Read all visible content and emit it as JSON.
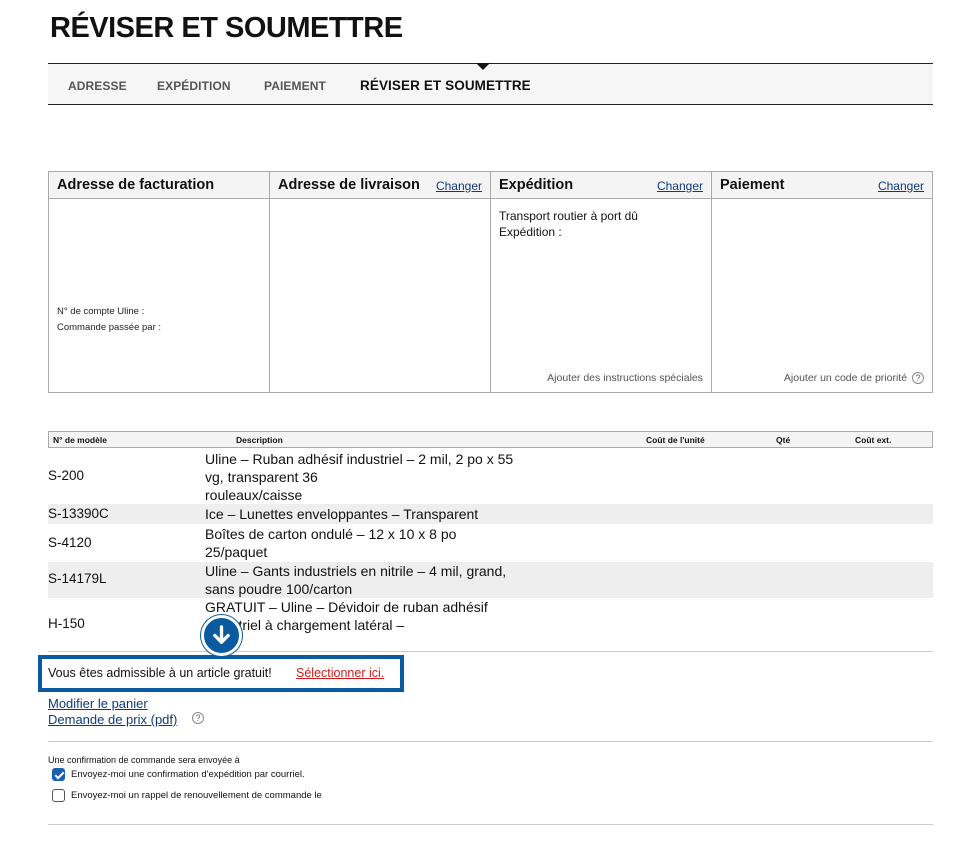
{
  "page": {
    "title": "RÉVISER ET SOUMETTRE"
  },
  "steps": [
    "ADRESSE",
    "EXPÉDITION",
    "PAIEMENT",
    "RÉVISER ET SOUMETTRE"
  ],
  "summary": {
    "billing": {
      "title": "Adresse de facturation",
      "account_label": "N° de compte Uline :",
      "ordered_by_label": "Commande passée par :"
    },
    "shipping_address": {
      "title": "Adresse de livraison",
      "change": "Changer"
    },
    "shipping": {
      "title": "Expédition",
      "change": "Changer",
      "line1": "Transport routier à port dû",
      "line2": "Expédition :",
      "special": "Ajouter des instructions spéciales"
    },
    "payment": {
      "title": "Paiement",
      "change": "Changer",
      "priority": "Ajouter un code de priorité",
      "help": "?"
    }
  },
  "table": {
    "headers": {
      "model": "N° de modèle",
      "description": "Description",
      "unit_cost": "Coût de l'unité",
      "qty": "Qté",
      "ext_cost": "Coût ext."
    },
    "rows": [
      {
        "model": "S-200",
        "lines": [
          "Uline – Ruban adhésif industriel – 2 mil, 2 po x 55",
          "vg, transparent 36",
          "rouleaux/caisse"
        ]
      },
      {
        "model": "S-13390C",
        "lines": [
          "Ice – Lunettes enveloppantes – Transparent"
        ]
      },
      {
        "model": "S-4120",
        "lines": [
          "Boîtes de carton ondulé – 12 x 10 x 8 po",
          "25/paquet"
        ]
      },
      {
        "model": "S-14179L",
        "lines": [
          "Uline – Gants industriels en nitrile – 4 mil, grand,",
          "sans poudre 100/carton"
        ]
      },
      {
        "model": "H-150",
        "lines": [
          "GRATUIT – Uline – Dévidoir de ruban adhésif",
          "industriel à chargement latéral –"
        ]
      }
    ]
  },
  "promo": {
    "text": "Vous êtes admissible à un article gratuit!",
    "link": "Sélectionner ici."
  },
  "links": {
    "modify_cart": "Modifier le panier",
    "quote_pdf": "Demande de prix (pdf)",
    "help": "?"
  },
  "confirmation": {
    "note": "Une confirmation de commande sera envoyée à",
    "ship_email": "Envoyez-moi une confirmation d'expédition par courriel.",
    "renewal": "Envoyez-moi un rappel de renouvellement de commande le"
  },
  "colors": {
    "accent": "#0a5aa0",
    "promo_link": "#d01c1c"
  }
}
